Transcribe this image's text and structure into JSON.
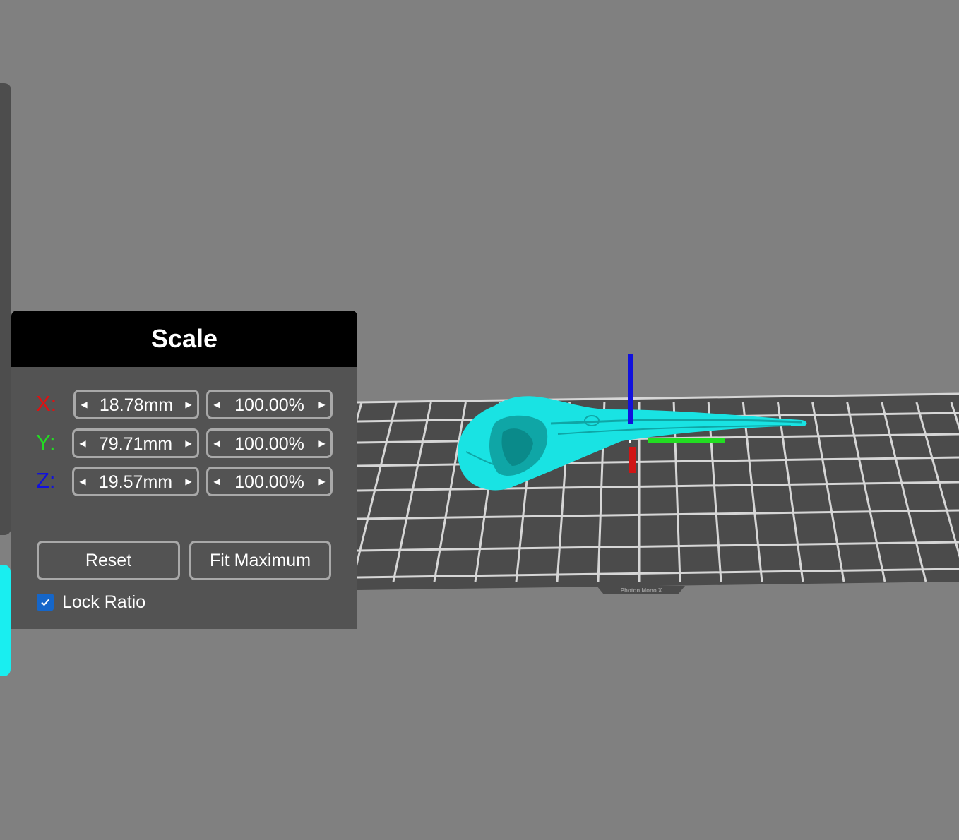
{
  "colors": {
    "background": "#808080",
    "model": "#19e3e3",
    "axis_x": "#e01010",
    "axis_y": "#22dd22",
    "axis_z": "#1111dd",
    "checkbox": "#1566c9"
  },
  "viewport": {
    "build_plate_label": "Photon Mono X"
  },
  "scale_panel": {
    "title": "Scale",
    "rows": [
      {
        "axis": "X:",
        "color": "#e01010",
        "size": "18.78mm",
        "percent": "100.00%"
      },
      {
        "axis": "Y:",
        "color": "#22dd22",
        "size": "79.71mm",
        "percent": "100.00%"
      },
      {
        "axis": "Z:",
        "color": "#1111dd",
        "size": "19.57mm",
        "percent": "100.00%"
      }
    ],
    "reset_label": "Reset",
    "fit_label": "Fit Maximum",
    "lock_ratio_label": "Lock Ratio",
    "lock_ratio_checked": true
  },
  "icons": {
    "decrement": "triangle-left-icon",
    "increment": "triangle-right-icon",
    "check": "check-icon"
  }
}
